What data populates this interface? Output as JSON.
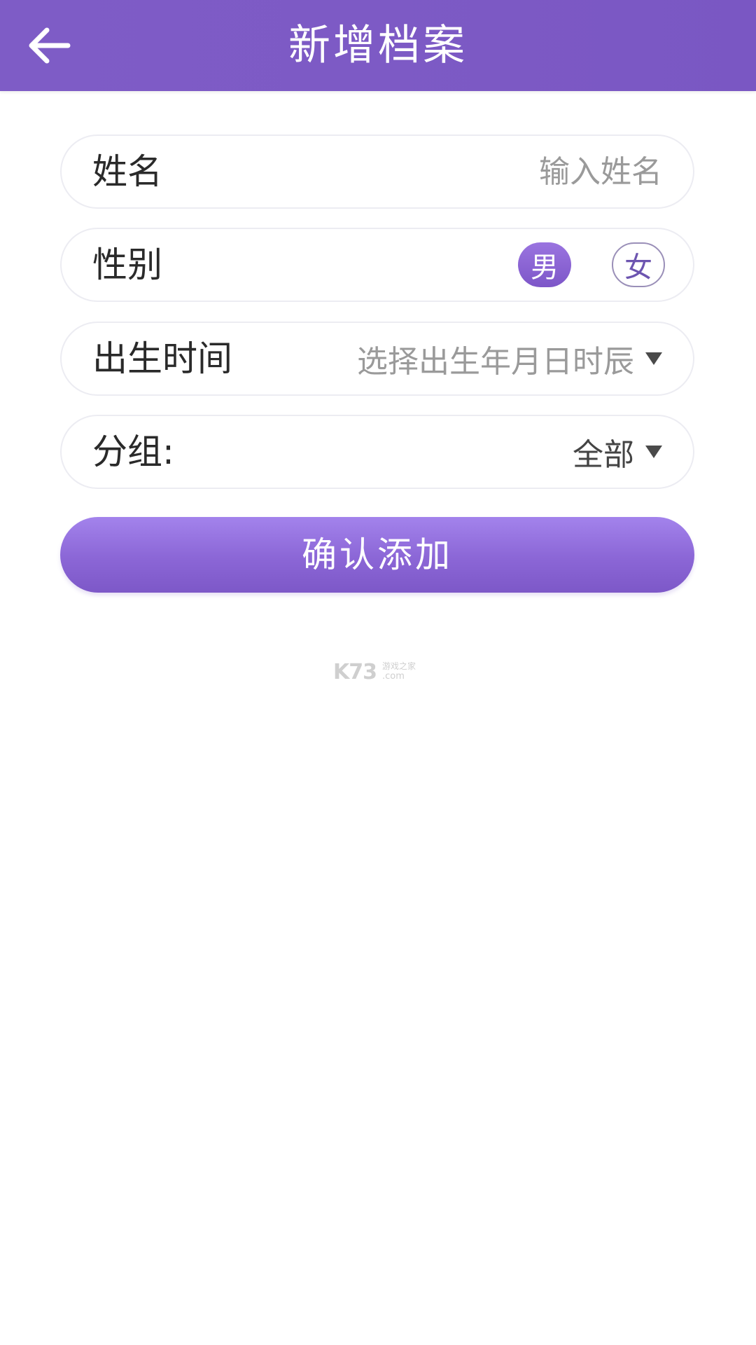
{
  "header": {
    "title": "新增档案",
    "back_icon": "arrow-left-icon",
    "background": "#7d5ac5"
  },
  "form": {
    "name": {
      "label": "姓名",
      "placeholder": "输入姓名",
      "value": ""
    },
    "gender": {
      "label": "性别",
      "options": [
        "男",
        "女"
      ],
      "selected": "男"
    },
    "birth": {
      "label": "出生时间",
      "placeholder": "选择出生年月日时辰",
      "dropdown_icon": "triangle-down-icon"
    },
    "group": {
      "label": "分组:",
      "value": "全部",
      "dropdown_icon": "triangle-down-icon"
    }
  },
  "confirm_button": {
    "label": "确认添加",
    "color": "#8b66d6"
  },
  "watermark": {
    "main": "K73",
    "top": "游戏之家",
    "bottom": ".com"
  }
}
